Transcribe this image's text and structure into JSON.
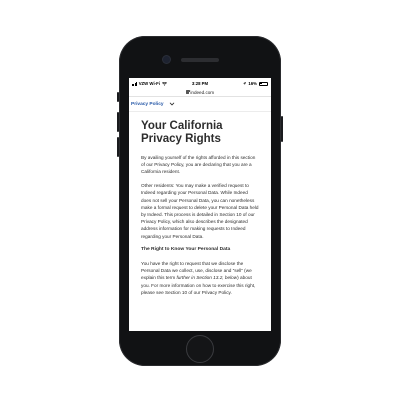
{
  "status_bar": {
    "carrier": "VZW Wi-Fi",
    "time": "3:28 PM",
    "battery": "16%",
    "battery_level": 0.16
  },
  "browser": {
    "url": "indeed.com"
  },
  "nav": {
    "policy_link": "Privacy Policy"
  },
  "page": {
    "title": "Your California Privacy Rights",
    "intro": "By availing yourself of the rights afforded in this section of our Privacy Policy, you are declaring that you are a California resident.",
    "other_residents": "Other residents: You may make a verified request to Indeed regarding your Personal Data. While Indeed does not sell your Personal Data, you can nonetheless make a formal request to delete your Personal Data held by Indeed. This process is detailed in Section 10 of our Privacy Policy, which also describes the designated address information for making requests to Indeed regarding your Personal Data.",
    "right_to_know_heading": "The Right to Know Your Personal Data",
    "right_to_know_p1": "You have the right to request that we disclose the Personal Data we collect, use, disclose and “sell” (we explain this term ",
    "right_to_know_italic": "further in Section 13.2, below",
    "right_to_know_p2": ") about you. For more information on how to exercise this right, please see Section 10 of our Privacy Policy."
  }
}
